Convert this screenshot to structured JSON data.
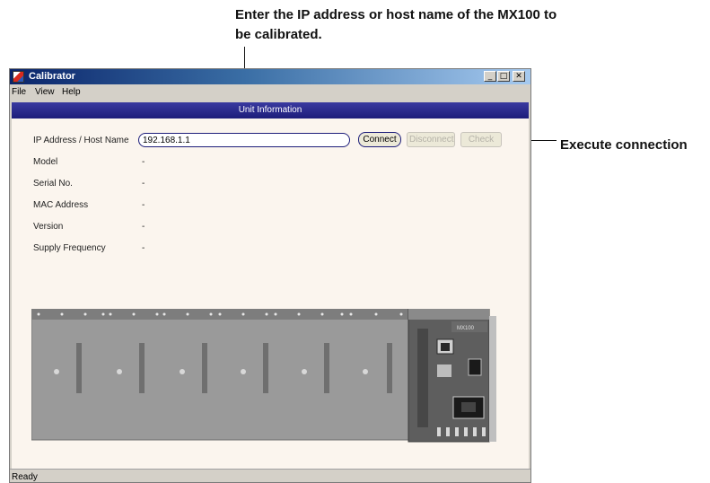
{
  "callouts": {
    "top": "Enter the IP address or host name of the MX100 to be calibrated.",
    "right": "Execute connection"
  },
  "window": {
    "title": "Calibrator",
    "controls": {
      "minimize": "_",
      "maximize": "□",
      "close": "✕"
    }
  },
  "menu": {
    "file": "File",
    "view": "View",
    "help": "Help"
  },
  "section": {
    "header": "Unit Information"
  },
  "fields": {
    "ip_label": "IP Address / Host Name",
    "ip_value": "192.168.1.1",
    "model_label": "Model",
    "model_value": "-",
    "serial_label": "Serial No.",
    "serial_value": "-",
    "mac_label": "MAC Address",
    "mac_value": "-",
    "version_label": "Version",
    "version_value": "-",
    "freq_label": "Supply Frequency",
    "freq_value": "-"
  },
  "buttons": {
    "connect": "Connect",
    "disconnect": "Disconnect",
    "check": "Check"
  },
  "device": {
    "brand": "MX100"
  },
  "status": {
    "text": "Ready"
  },
  "colors": {
    "title_bar": "#0a246a",
    "section_header": "#1d1d7a",
    "client_background": "#fbf5ee",
    "window_chrome": "#d4d0c8"
  }
}
